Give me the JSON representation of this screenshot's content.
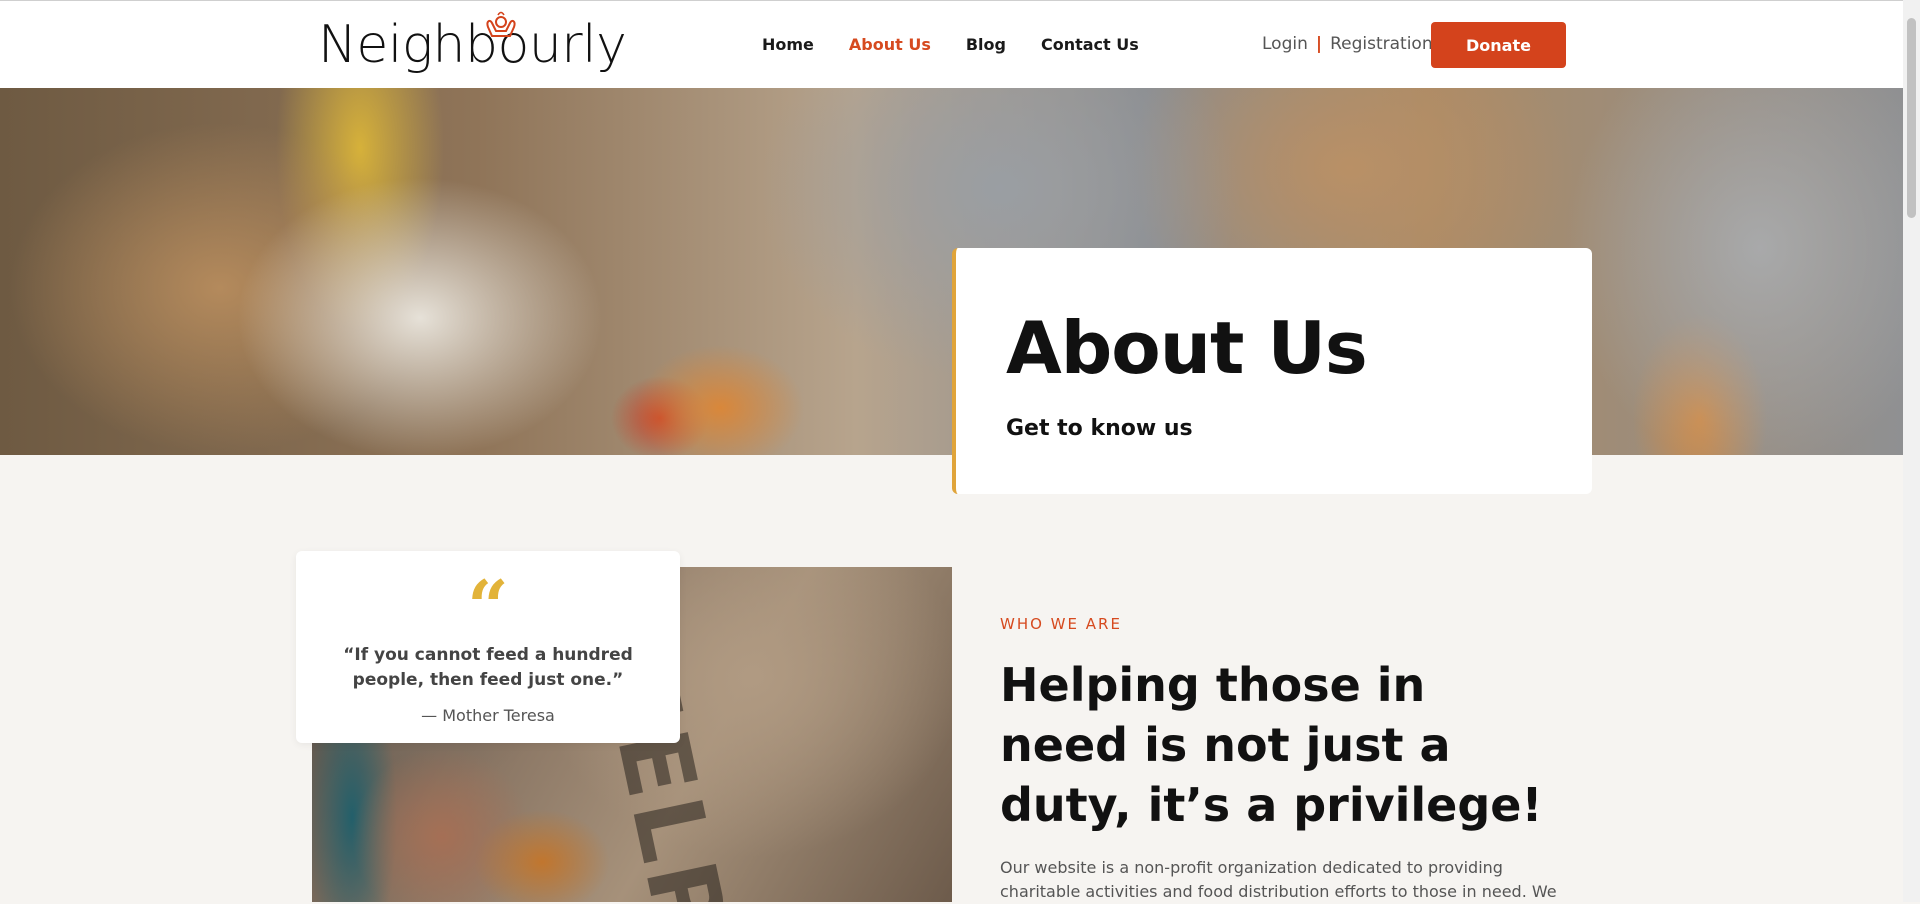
{
  "header": {
    "logo": "Neighbourly",
    "nav": [
      "Home",
      "About Us",
      "Blog",
      "Contact Us"
    ],
    "active_nav": "About Us",
    "login": "Login",
    "registration": "Registration",
    "donate": "Donate"
  },
  "hero": {
    "title": "About Us",
    "subtitle": "Get to know us"
  },
  "quote": {
    "text": "“If you cannot feed a hundred people, then feed just one.”",
    "author": "— Mother Teresa"
  },
  "intro": {
    "eyebrow": "WHO WE ARE",
    "heading": "Helping those in need is not just a duty, it’s a privilege!",
    "body": "Our website is a non-profit organization dedicated to providing charitable activities and food distribution efforts to those in need. We"
  },
  "photo": {
    "sign_text": "HELP"
  },
  "colors": {
    "accent": "#d4431c",
    "quote_gold": "#e2b339",
    "hero_border": "#e0a43a"
  }
}
